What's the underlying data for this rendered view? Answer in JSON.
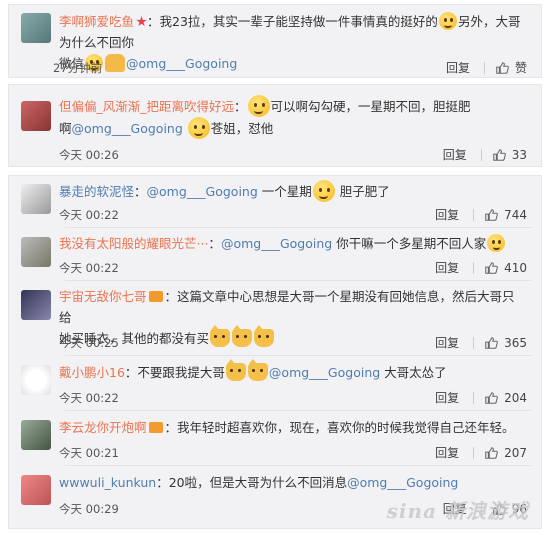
{
  "comments": [
    {
      "username": "李啊狮爱吃鱼",
      "part1": "：我23拉，其实一辈子能坚持做一件事情真的挺好的",
      "part2": "另外，大哥为什么不回你",
      "part3": "微信",
      "mention": "@omg___Gogoing",
      "part4": "",
      "time": "27分钟前",
      "reply": "回复",
      "likes": "赞"
    },
    {
      "username": "但偏偏_风渐渐_把距离吹得好远",
      "part1": "：",
      "part2": "可以啊勾勾硬，一星期不回，胆挺肥",
      "part3": "啊",
      "mention": "@omg___Gogoing",
      "part4": "苍姐，怼他",
      "time": "今天 00:26",
      "reply": "回复",
      "likes": "33"
    },
    {
      "username": "暴走的软泥怪",
      "part1": "：",
      "mention": "@omg___Gogoing",
      "part2": "一个星期",
      "part3": "胆子肥了",
      "time": "今天 00:22",
      "reply": "回复",
      "likes": "744"
    },
    {
      "username": "我没有太阳般的耀眼光芒···",
      "part1": "：",
      "mention": "@omg___Gogoing",
      "part2": "你干嘛一个多星期不回人家",
      "time": "今天 00:22",
      "reply": "回复",
      "likes": "410"
    },
    {
      "username": "宇宙无敌你七哥",
      "part1": "：这篇文章中心思想是大哥一个星期没有回她信息，然后大哥只给",
      "part2": "她买睡衣，其他的都没有买",
      "time": "今天 00:25",
      "reply": "回复",
      "likes": "365"
    },
    {
      "username": "戴小鹏小16",
      "part1": "：不要跟我提大哥",
      "mention": "@omg___Gogoing",
      "part2": "大哥太怂了",
      "time": "今天 00:22",
      "reply": "回复",
      "likes": "204"
    },
    {
      "username": "李云龙你开炮啊",
      "part1": "：我年轻时超喜欢你，现在，喜欢你的时候我觉得自己还年轻。",
      "time": "今天 00:21",
      "reply": "回复",
      "likes": "207"
    },
    {
      "username": "wwwuli_kunkun",
      "part1": "：20啦，但是大哥为什么不回消息",
      "mention": "@omg___Gogoing",
      "time": "今天 00:29",
      "reply": "回复",
      "likes": "96"
    }
  ],
  "watermark": "sina 新浪游戏",
  "colors": {
    "username": "#eb7350",
    "mention": "#507daf",
    "panel_bg": "#f2f2f5"
  },
  "icons": [
    "thumbs-up-icon",
    "smile-emoji",
    "cat-emoji",
    "pray-hands-emoji",
    "star-badge-icon"
  ]
}
